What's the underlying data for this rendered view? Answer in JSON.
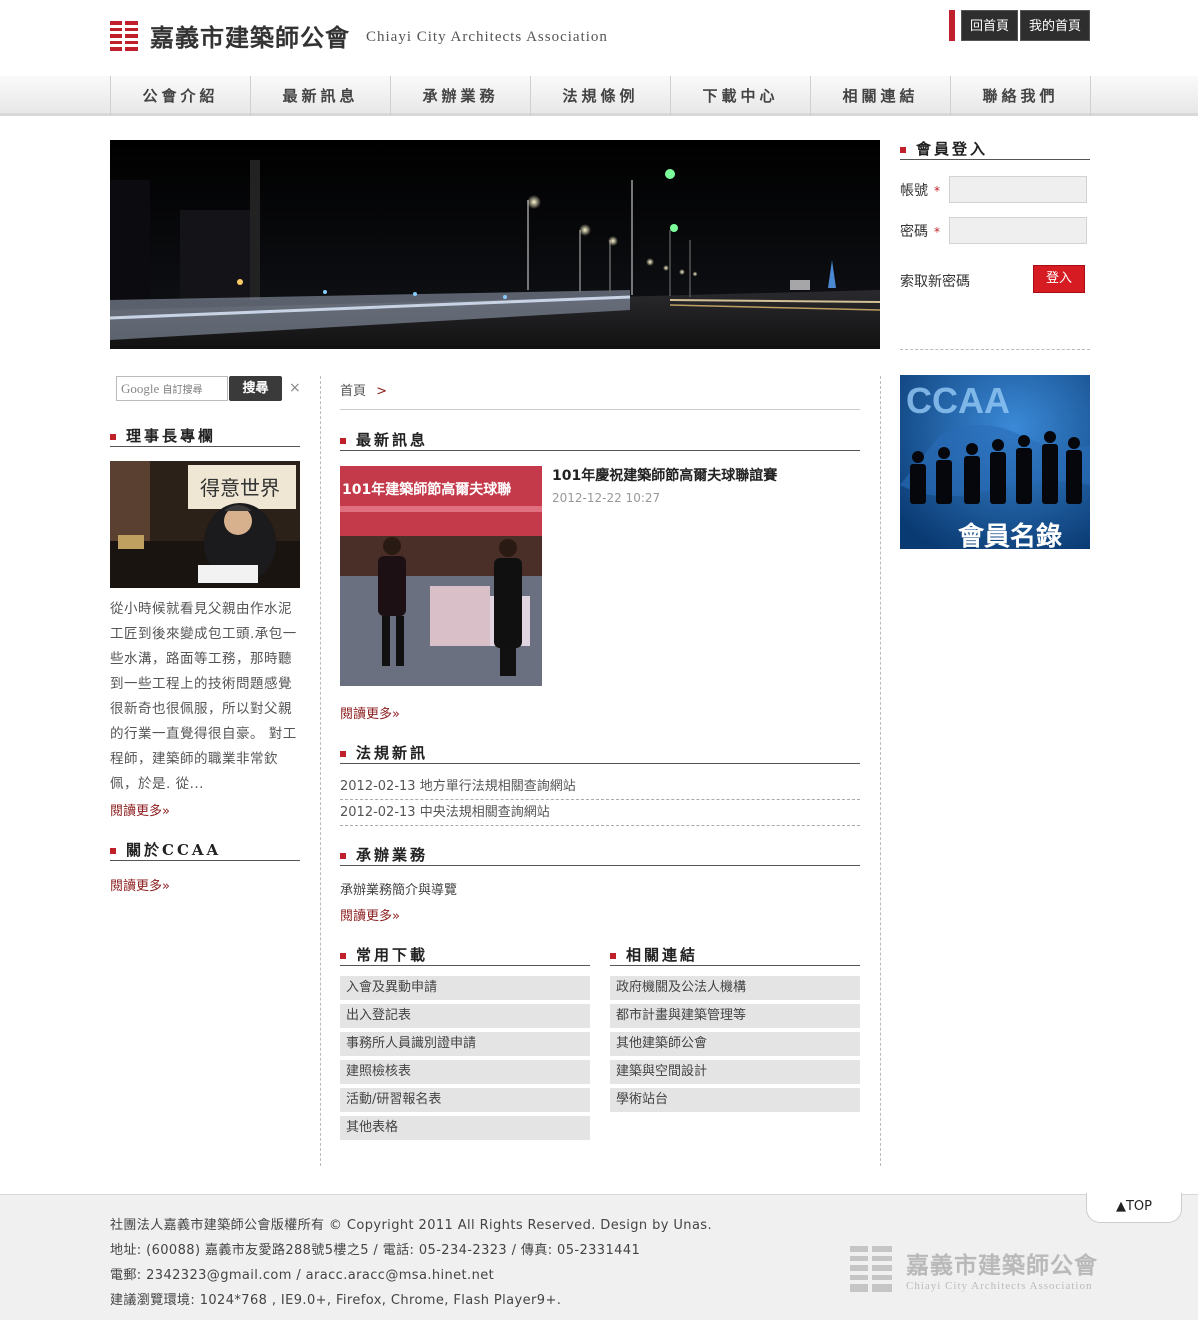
{
  "header": {
    "logo_cn": "嘉義市建築師公會",
    "logo_en": "Chiayi City Architects Association",
    "home_button": "回首頁",
    "my_home_button": "我的首頁"
  },
  "nav": [
    "公會介紹",
    "最新訊息",
    "承辦業務",
    "法規條例",
    "下載中心",
    "相關連結",
    "聯絡我們"
  ],
  "login": {
    "title": "會員登入",
    "account_label": "帳號",
    "password_label": "密碼",
    "required_mark": "*",
    "forgot_password": "索取新密碼",
    "login_button": "登入"
  },
  "search": {
    "brand": "Google",
    "placeholder": "自訂搜尋",
    "button": "搜尋",
    "clear": "×"
  },
  "chief_column": {
    "title": "理事長專欄",
    "excerpt": "從小時候就看見父親由作水泥工匠到後來變成包工頭.承包一些水溝，路面等工務，那時聽到一些工程上的技術問題感覺很新奇也很佩服，所以對父親的行業一直覺得很自豪。 對工程師，建築師的職業非常欽佩，於是. 從...",
    "more": "閱讀更多»"
  },
  "about": {
    "title": "關於CCAA",
    "more": "閱讀更多»"
  },
  "breadcrumb": {
    "home": "首頁",
    "sep": ">"
  },
  "latest_news": {
    "title": "最新訊息",
    "item_title": "101年慶祝建築師節高爾夫球聯誼賽",
    "item_date": "2012-12-22 10:27",
    "photo_banner": "101年建築師節高爾夫球聯",
    "more": "閱讀更多»"
  },
  "law_news": {
    "title": "法規新訊",
    "items": [
      {
        "date": "2012-02-13",
        "text": "地方單行法規相關查詢網站"
      },
      {
        "date": "2012-02-13",
        "text": "中央法規相關查詢網站"
      }
    ]
  },
  "business": {
    "title": "承辦業務",
    "text": "承辦業務簡介與導覽",
    "more": "閱讀更多»"
  },
  "downloads": {
    "title": "常用下載",
    "items": [
      "入會及異動申請",
      "出入登記表",
      "事務所人員識別證申請",
      "建照檢核表",
      "活動/研習報名表",
      "其他表格"
    ]
  },
  "links": {
    "title": "相關連結",
    "items": [
      "政府機關及公法人機構",
      "都市計畫與建築管理等",
      "其他建築師公會",
      "建築與空間設計",
      "學術站台"
    ]
  },
  "member_list": {
    "logo": "CCAA",
    "label": "會員名錄"
  },
  "footer": {
    "top_button": "▲TOP",
    "line1": "社團法人嘉義市建築師公會版權所有 © Copyright 2011 All Rights Reserved. Design by Unas.",
    "line2": "地址: (60088) 嘉義市友愛路288號5樓之5 / 電話: 05-234-2323 / 傳真: 05-2331441",
    "line3": "電郵: 2342323@gmail.com / aracc.aracc@msa.hinet.net",
    "line4": "建議瀏覽環境: 1024*768 , IE9.0+, Firefox, Chrome, Flash Player9+.",
    "logo_cn": "嘉義市建築師公會",
    "logo_en": "Chiayi City Architects Association"
  },
  "colors": {
    "accent": "#c0202a",
    "link": "#8c1d1d"
  }
}
